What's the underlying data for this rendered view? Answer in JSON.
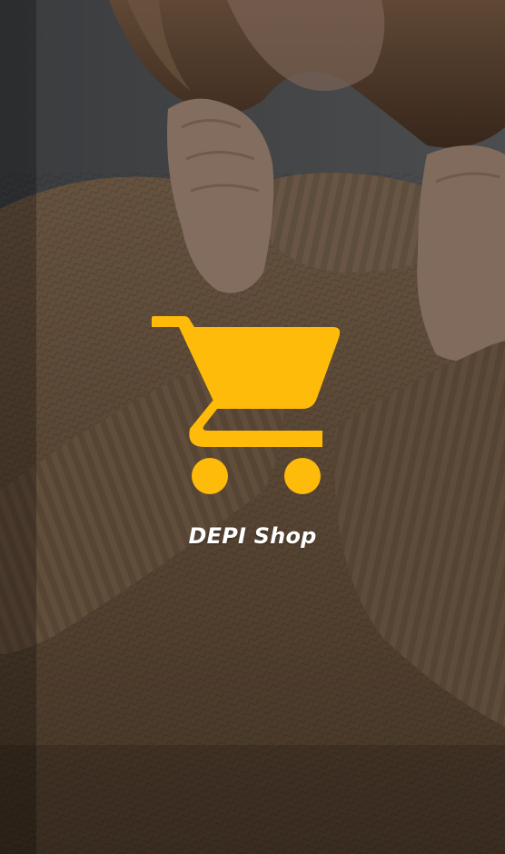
{
  "app": {
    "name": "DEPI Shop"
  },
  "logo": {
    "icon": "shopping-cart-icon",
    "color": "#FFBB0A"
  },
  "background": {
    "scrim_color": "#000000",
    "scrim_opacity": 0.38
  }
}
